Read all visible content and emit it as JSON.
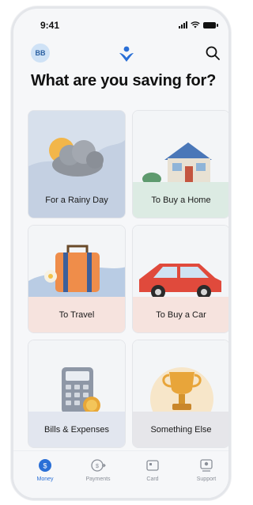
{
  "status_bar": {
    "time": "9:41"
  },
  "header": {
    "avatar_initials": "BB",
    "logo_icon": "brand-logo-icon",
    "search_icon": "search-icon"
  },
  "title": "What are you saving for?",
  "goals": [
    {
      "label": "For a Rainy Day",
      "icon": "rainy-cloud-icon",
      "color": "#c8d4e4"
    },
    {
      "label": "To Buy a Home",
      "icon": "house-icon",
      "color": "#dcebe3"
    },
    {
      "label": "To Travel",
      "icon": "suitcase-icon",
      "color": "#f6e3de"
    },
    {
      "label": "To Buy a Car",
      "icon": "car-icon",
      "color": "#f6e3de"
    },
    {
      "label": "Bills & Expenses",
      "icon": "calculator-icon",
      "color": "#e2e6ef"
    },
    {
      "label": "Something Else",
      "icon": "trophy-icon",
      "color": "#e6e6ea"
    }
  ],
  "tabbar": {
    "tabs": [
      {
        "label": "Money",
        "icon": "money-icon",
        "active": true
      },
      {
        "label": "Payments",
        "icon": "payments-icon",
        "active": false
      },
      {
        "label": "Card",
        "icon": "card-icon",
        "active": false
      },
      {
        "label": "Support",
        "icon": "support-icon",
        "active": false
      }
    ]
  },
  "colors": {
    "accent": "#2a6fd6"
  }
}
